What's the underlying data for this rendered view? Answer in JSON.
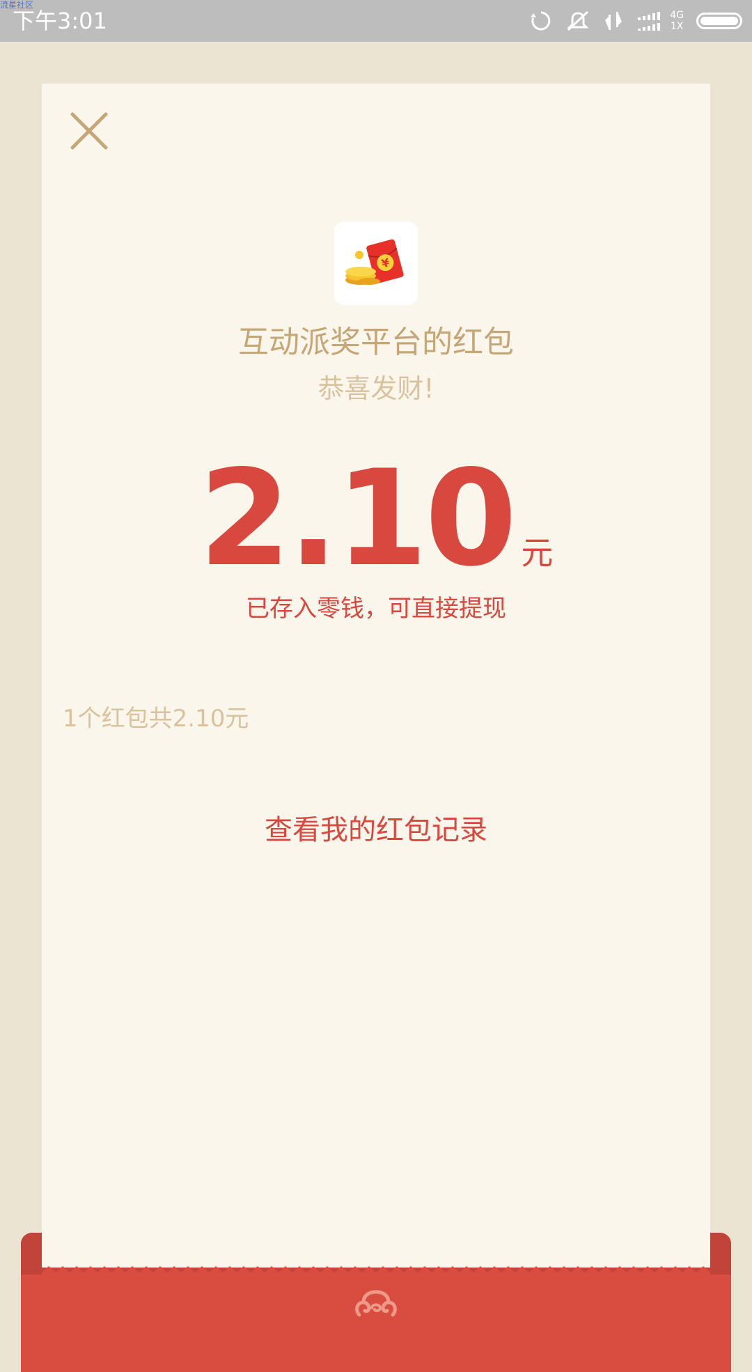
{
  "status_bar": {
    "watermark": "流星社区",
    "time": "下午3:01",
    "network_top": "4G",
    "network_bottom": "1X"
  },
  "red_packet": {
    "sender": "互动派奖平台的红包",
    "greeting": "恭喜发财!",
    "amount": "2.10",
    "unit": "元",
    "saved_notice": "已存入零钱，可直接提现",
    "summary": "1个红包共2.10元",
    "records_link": "查看我的红包记录"
  },
  "icons": {
    "close": "close-icon",
    "app": "red-packet-coins-icon",
    "emblem": "auspicious-cloud-icon"
  },
  "colors": {
    "accent_red": "#d9483f",
    "gold_text": "#c5a676",
    "light_gold": "#d8c39e",
    "card_bg": "#faf6ec",
    "page_bg": "#ece4d2"
  }
}
